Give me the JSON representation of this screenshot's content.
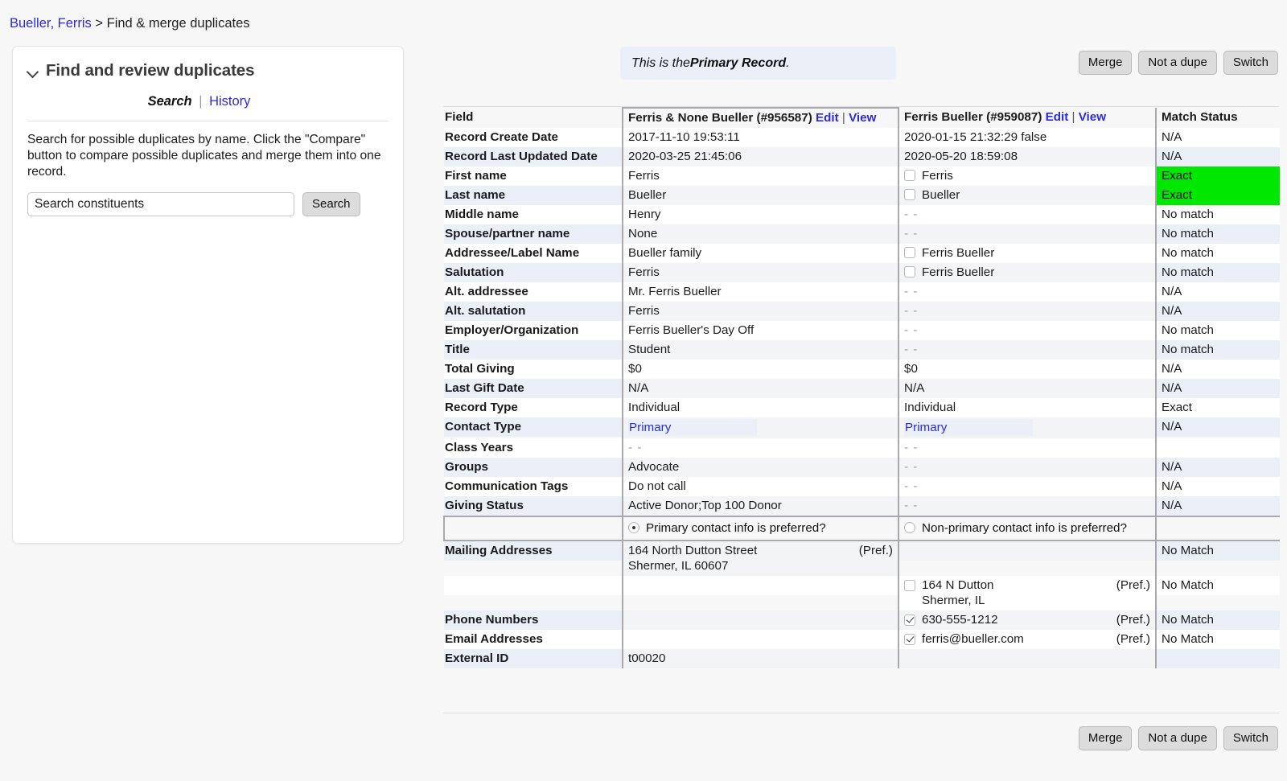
{
  "breadcrumb": {
    "link": "Bueller, Ferris",
    "separator": ">",
    "current": "Find & merge duplicates"
  },
  "search_card": {
    "title": "Find and review duplicates",
    "collapse_icon": "chevron-down-icon",
    "tabs": {
      "active": "Search",
      "separator": "|",
      "link": "History"
    },
    "description": "Search for possible duplicates by name. Click the \"Compare\" button to compare possible duplicates and merge them into one record.",
    "search_placeholder": "Search constituents",
    "search_value": "",
    "search_button": "Search"
  },
  "banner": {
    "prefix": "This is the ",
    "strong": "Primary Record",
    "suffix": "."
  },
  "actions": {
    "merge": "Merge",
    "not_a_dupe": "Not a dupe",
    "switch": "Switch"
  },
  "table": {
    "headers": {
      "field": "Field",
      "record_a": "Ferris & None Bueller (#956587)",
      "record_b": "Ferris Bueller (#959087)",
      "edit": "Edit",
      "pipe": "|",
      "view": "View",
      "status": "Match Status"
    },
    "rows": [
      {
        "field": "Record Create Date",
        "a": "2017-11-10 19:53:11",
        "b": "2020-01-15 21:32:29 false",
        "b_cb": false,
        "status": "N/A"
      },
      {
        "field": "Record Last Updated Date",
        "a": "2020-03-25 21:45:06",
        "b": "2020-05-20 18:59:08",
        "b_cb": false,
        "status": "N/A"
      },
      {
        "field": "First name",
        "a": "Ferris",
        "b": "Ferris",
        "b_cb": true,
        "status": "Exact",
        "exact": true
      },
      {
        "field": "Last name",
        "a": "Bueller",
        "b": "Bueller",
        "b_cb": true,
        "status": "Exact",
        "exact": true
      },
      {
        "field": "Middle name",
        "a": "Henry",
        "b": "- -",
        "b_dash": true,
        "b_cb": false,
        "status": "No match"
      },
      {
        "field": "Spouse/partner name",
        "a": "None",
        "b": "- -",
        "b_dash": true,
        "b_cb": false,
        "status": "No match"
      },
      {
        "field": "Addressee/Label Name",
        "a": "Bueller family",
        "b": "Ferris Bueller",
        "b_cb": true,
        "status": "No match"
      },
      {
        "field": "Salutation",
        "a": "Ferris",
        "b": "Ferris Bueller",
        "b_cb": true,
        "status": "No match"
      },
      {
        "field": "Alt. addressee",
        "a": "Mr. Ferris Bueller",
        "b": "- -",
        "b_dash": true,
        "b_cb": false,
        "status": "N/A"
      },
      {
        "field": "Alt. salutation",
        "a": "Ferris",
        "b": "- -",
        "b_dash": true,
        "b_cb": false,
        "status": "N/A"
      },
      {
        "field": "Employer/Organization",
        "a": "Ferris Bueller's Day Off",
        "b": "- -",
        "b_dash": true,
        "b_cb": false,
        "status": "No match"
      },
      {
        "field": "Title",
        "a": "Student",
        "b": "- -",
        "b_dash": true,
        "b_cb": false,
        "status": "No match"
      },
      {
        "field": "Total Giving",
        "a": "$0",
        "b": "$0",
        "b_cb": false,
        "status": "N/A"
      },
      {
        "field": "Last Gift Date",
        "a": "N/A",
        "b": "N/A",
        "b_cb": false,
        "status": "N/A"
      },
      {
        "field": "Record Type",
        "a": "Individual",
        "b": "Individual",
        "b_cb": false,
        "status": "Exact"
      },
      {
        "field": "Contact Type",
        "a": "Primary",
        "a_pill": true,
        "b": "Primary",
        "b_pill": true,
        "b_cb": false,
        "status": "N/A"
      },
      {
        "field": "Class Years",
        "a": "- -",
        "a_dash": true,
        "b": "- -",
        "b_dash": true,
        "b_cb": false,
        "status": ""
      },
      {
        "field": "Groups",
        "a": "Advocate",
        "b": "- -",
        "b_dash": true,
        "b_cb": false,
        "status": "N/A"
      },
      {
        "field": "Communication Tags",
        "a": "Do not call",
        "b": "- -",
        "b_dash": true,
        "b_cb": false,
        "status": "N/A"
      },
      {
        "field": "Giving Status",
        "a": "Active Donor;Top 100 Donor",
        "b": "- -",
        "b_dash": true,
        "b_cb": false,
        "status": "N/A"
      }
    ],
    "preference_row": {
      "primary_label": "Primary contact info is preferred?",
      "primary_selected": true,
      "nonprimary_label": "Non-primary contact info is preferred?",
      "nonprimary_selected": false
    },
    "contact_rows": [
      {
        "field": "Mailing Addresses",
        "a_lines": [
          "164 North Dutton Street",
          "Shermer, IL 60607"
        ],
        "a_pref": "(Pref.)",
        "b_lines": [],
        "b_pref": "",
        "b_cb": null,
        "status": "No Match"
      },
      {
        "field": "",
        "a_lines": [],
        "a_pref": "",
        "b_lines": [
          "164 N Dutton",
          "Shermer, IL"
        ],
        "b_pref": "(Pref.)",
        "b_cb": false,
        "status": "No Match"
      },
      {
        "field": "Phone Numbers",
        "a_lines": [],
        "a_pref": "",
        "b_lines": [
          "630-555-1212"
        ],
        "b_pref": "(Pref.)",
        "b_cb": true,
        "status": "No Match"
      },
      {
        "field": "Email Addresses",
        "a_lines": [],
        "a_pref": "",
        "b_lines": [
          "ferris@bueller.com"
        ],
        "b_pref": "(Pref.)",
        "b_cb": true,
        "status": "No Match"
      },
      {
        "field": "External ID",
        "a_lines": [
          "t00020"
        ],
        "a_pref": "",
        "b_lines": [],
        "b_pref": "",
        "b_cb": null,
        "status": ""
      }
    ]
  },
  "colors": {
    "link": "#2b2bdd",
    "exact_match": "#00e800",
    "row_alt": "#eaeff8",
    "banner_bg": "#eaeff8"
  }
}
